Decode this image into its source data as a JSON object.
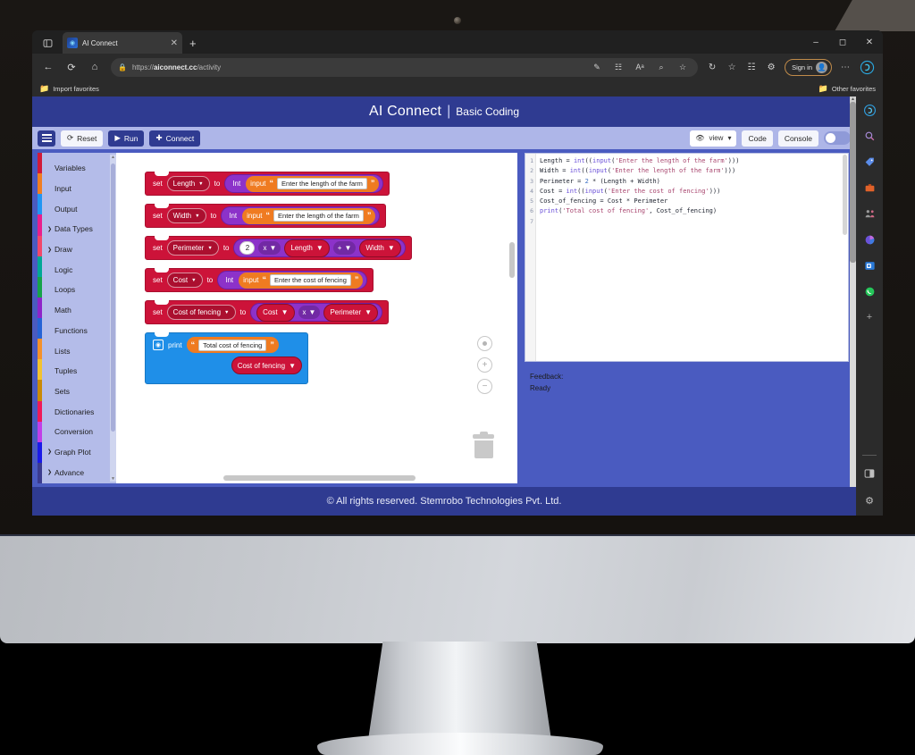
{
  "browser": {
    "tab": {
      "title": "AI Connect",
      "favicon_icon": "ai-connect-favicon",
      "close_icon": "close-icon"
    },
    "new_tab_icon": "plus-icon",
    "tab_search_icon": "tab-list-icon",
    "window_controls": {
      "minimize": "minimize-icon",
      "maximize": "maximize-icon",
      "close": "close-icon"
    },
    "nav": {
      "back_icon": "back-arrow-icon",
      "refresh_icon": "refresh-icon",
      "home_icon": "home-icon"
    },
    "url": {
      "lock_icon": "lock-icon",
      "prefix": "https://",
      "domain": "aiconnect.cc",
      "path": "/activity"
    },
    "url_icons": [
      "pen-icon",
      "split-screen-icon",
      "read-aloud-icon",
      "zoom-icon",
      "favorite-star-icon"
    ],
    "toolbar_icons": [
      "history-icon",
      "collections-star-icon",
      "browser-essentials-icon",
      "extensions-icon"
    ],
    "signin": {
      "label": "Sign in",
      "avatar_icon": "account-avatar-icon"
    },
    "more_icon": "ellipsis-icon",
    "copilot_icon": "copilot-icon",
    "favorites": {
      "import_label": "Import favorites",
      "import_icon": "import-favorites-icon",
      "other_label": "Other favorites",
      "other_icon": "folder-icon"
    },
    "sidebar_icons": [
      "copilot-icon",
      "search-icon",
      "shopping-tag-icon",
      "tools-icon",
      "split-people-icon",
      "office-icon",
      "outlook-icon",
      "whatsapp-icon",
      "add-icon"
    ],
    "sidebar_bottom_icons": [
      "sidebar-toggle-icon",
      "settings-gear-icon"
    ]
  },
  "app": {
    "header": {
      "title": "AI Connect",
      "separator": "|",
      "subtitle": "Basic Coding"
    },
    "toolbar": {
      "menu_icon": "hamburger-menu-icon",
      "reset_label": "Reset",
      "reset_icon": "refresh-icon",
      "run_label": "Run",
      "run_icon": "play-icon",
      "connect_label": "Connect",
      "connect_icon": "plus-icon",
      "view_label": "view",
      "view_icon": "eye-icon",
      "view_caret": "chevron-down-icon",
      "code_label": "Code",
      "console_label": "Console",
      "toggle_state": "off"
    },
    "toolbox": {
      "items": [
        {
          "label": "Variables",
          "color": "#d11a3a",
          "expandable": false
        },
        {
          "label": "Input",
          "color": "#f07e22",
          "expandable": false
        },
        {
          "label": "Output",
          "color": "#2196f3",
          "expandable": false
        },
        {
          "label": "Data Types",
          "color": "#e91e8c",
          "expandable": true
        },
        {
          "label": "Draw",
          "color": "#f2476a",
          "expandable": true
        },
        {
          "label": "Logic",
          "color": "#00a896",
          "expandable": false
        },
        {
          "label": "Loops",
          "color": "#16a34a",
          "expandable": false
        },
        {
          "label": "Math",
          "color": "#8e24c9",
          "expandable": false
        },
        {
          "label": "Functions",
          "color": "#2663d6",
          "expandable": false
        },
        {
          "label": "Lists",
          "color": "#f4912b",
          "expandable": false
        },
        {
          "label": "Tuples",
          "color": "#f2c230",
          "expandable": false
        },
        {
          "label": "Sets",
          "color": "#c98a06",
          "expandable": false
        },
        {
          "label": "Dictionaries",
          "color": "#ef1a5a",
          "expandable": false
        },
        {
          "label": "Conversion",
          "color": "#c13fe8",
          "expandable": false
        },
        {
          "label": "Graph Plot",
          "color": "#1a1ae8",
          "expandable": true
        },
        {
          "label": "Advance",
          "color": "#3b3b8f",
          "expandable": true
        }
      ],
      "scroll_up_icon": "scroll-up-arrow",
      "scroll_down_icon": "scroll-down-arrow"
    },
    "blocks": [
      {
        "type": "set-int-input",
        "set": "set",
        "variable": "Length",
        "to": "to",
        "cast": "Int",
        "input": "input",
        "value": "Enter the length of the farm"
      },
      {
        "type": "set-int-input",
        "set": "set",
        "variable": "Width",
        "to": "to",
        "cast": "Int",
        "input": "input",
        "value": "Enter the length of the farm"
      },
      {
        "type": "set-math",
        "set": "set",
        "variable": "Perimeter",
        "to": "to",
        "number": "2",
        "op1": "x",
        "operand1": "Length",
        "op2": "+",
        "operand2": "Width"
      },
      {
        "type": "set-int-input",
        "set": "set",
        "variable": "Cost",
        "to": "to",
        "cast": "Int",
        "input": "input",
        "value": "Enter the cost of fencing"
      },
      {
        "type": "set-mult",
        "set": "set",
        "variable": "Cost of fencing",
        "to": "to",
        "operand1": "Cost",
        "op": "x",
        "operand2": "Perimeter"
      },
      {
        "type": "print",
        "print": "print",
        "text": "Total cost of fencing",
        "variable": "Cost of fencing"
      }
    ],
    "workspace_controls": {
      "center_icon": "center-target-icon",
      "zoom_in_icon": "zoom-in-icon",
      "zoom_in_label": "+",
      "zoom_out_icon": "zoom-out-icon",
      "zoom_out_label": "−",
      "trash_icon": "trash-can-icon"
    },
    "code": {
      "line_numbers": [
        "1",
        "2",
        "3",
        "4",
        "5",
        "6",
        "7"
      ],
      "lines": [
        "Length = int((input('Enter the length of the farm')))",
        "Width = int((input('Enter the length of the farm')))",
        "Perimeter = 2 * (Length + Width)",
        "Cost = int((input('Enter the cost of fencing')))",
        "Cost_of_fencing = Cost * Perimeter",
        "print('Total cost of fencing', Cost_of_fencing)",
        ""
      ]
    },
    "feedback": {
      "label": "Feedback:",
      "status": "Ready"
    },
    "footer": {
      "text": "© All rights reserved. Stemrobo Technologies Pvt. Ltd."
    }
  },
  "colors": {
    "header_blue": "#2f3b91",
    "body_blue": "#4a5bc0",
    "toolbar_lavender": "#aeb6e8",
    "toolbox_lavender": "#b4bce9",
    "block_red": "#cc1339",
    "block_purple": "#8c32c9",
    "block_orange": "#ef7b21",
    "block_blue": "#1f8fe8"
  }
}
